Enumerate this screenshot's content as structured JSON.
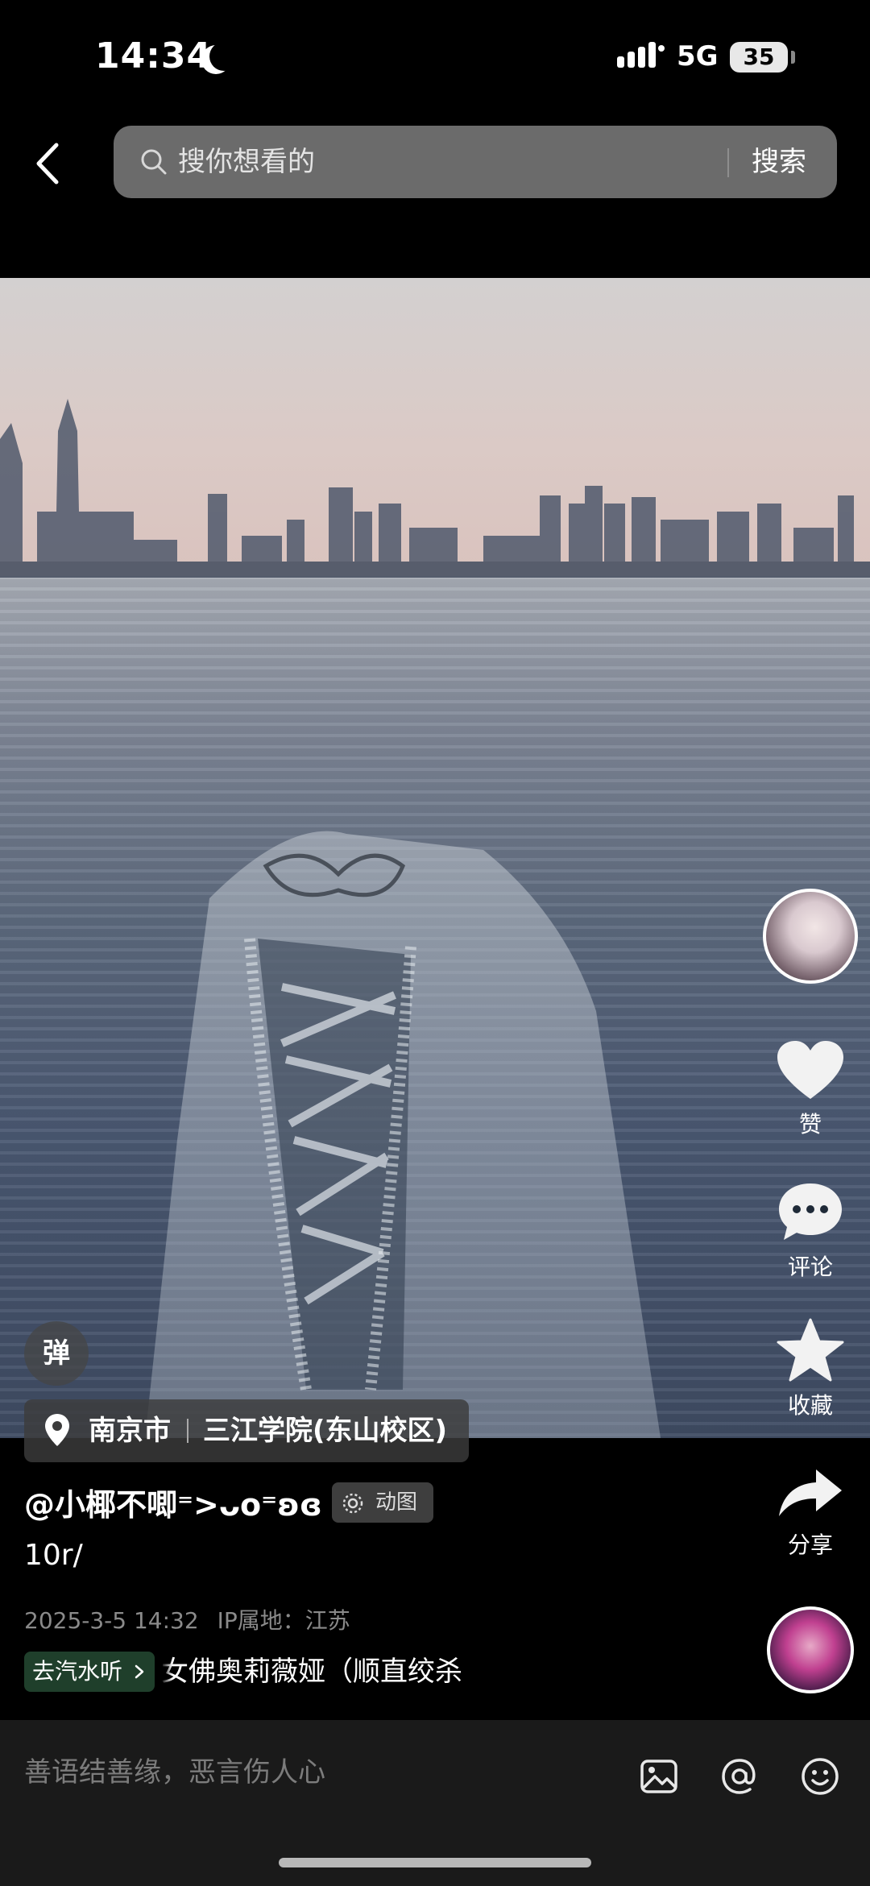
{
  "status_bar": {
    "time": "14:34",
    "network": "5G",
    "battery": "35"
  },
  "search": {
    "placeholder": "搜你想看的",
    "button_label": "搜索"
  },
  "actions": {
    "like_label": "赞",
    "comment_label": "评论",
    "favorite_label": "收藏",
    "share_label": "分享"
  },
  "danmu_label": "弹",
  "location": {
    "city": "南京市",
    "place": "三江学院(东山校区)"
  },
  "post": {
    "username": "@小椰不唧⁼>ᴗo⁼ʚɞ",
    "badge_label": "动图",
    "caption": "10r/",
    "date": "2025-3-5 14:32",
    "ip_location": "IP属地：江苏"
  },
  "music": {
    "pill_label": "去汽水听",
    "track": "女佛奥莉薇娅（顺直绞杀"
  },
  "comment": {
    "placeholder": "善语结善缘，恶言伤人心"
  },
  "colors": {
    "background": "#000000",
    "search_bg": "#6b6b6b",
    "comment_bar_bg": "#1a1a1a",
    "music_pill_bg": "#1f3f2b"
  }
}
